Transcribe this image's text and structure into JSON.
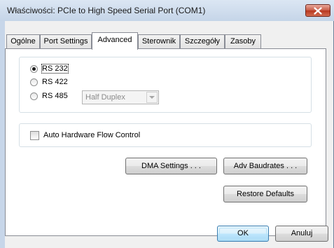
{
  "window": {
    "title": "Właściwości: PCIe to High Speed Serial Port (COM1)",
    "close_icon": "close-icon"
  },
  "tabs": [
    {
      "label": "Ogólne",
      "active": false
    },
    {
      "label": "Port Settings",
      "active": false
    },
    {
      "label": "Advanced",
      "active": true
    },
    {
      "label": "Sterownik",
      "active": false
    },
    {
      "label": "Szczegóły",
      "active": false
    },
    {
      "label": "Zasoby",
      "active": false
    }
  ],
  "interface": {
    "options": [
      {
        "label": "RS 232",
        "checked": true
      },
      {
        "label": "RS 422",
        "checked": false
      },
      {
        "label": "RS 485",
        "checked": false
      }
    ],
    "duplex_select": {
      "value": "Half Duplex",
      "disabled": true
    }
  },
  "flow_control": {
    "label": "Auto Hardware Flow Control",
    "checked": false
  },
  "buttons": {
    "dma_settings": "DMA Settings . . .",
    "adv_baudrates": "Adv Baudrates . . .",
    "restore_defaults": "Restore Defaults"
  },
  "dialog_buttons": {
    "ok": "OK",
    "cancel": "Anuluj"
  },
  "colors": {
    "close_button": "#c75a45",
    "default_button_border": "#3c7fb1",
    "frame": "#c7d6e9"
  }
}
